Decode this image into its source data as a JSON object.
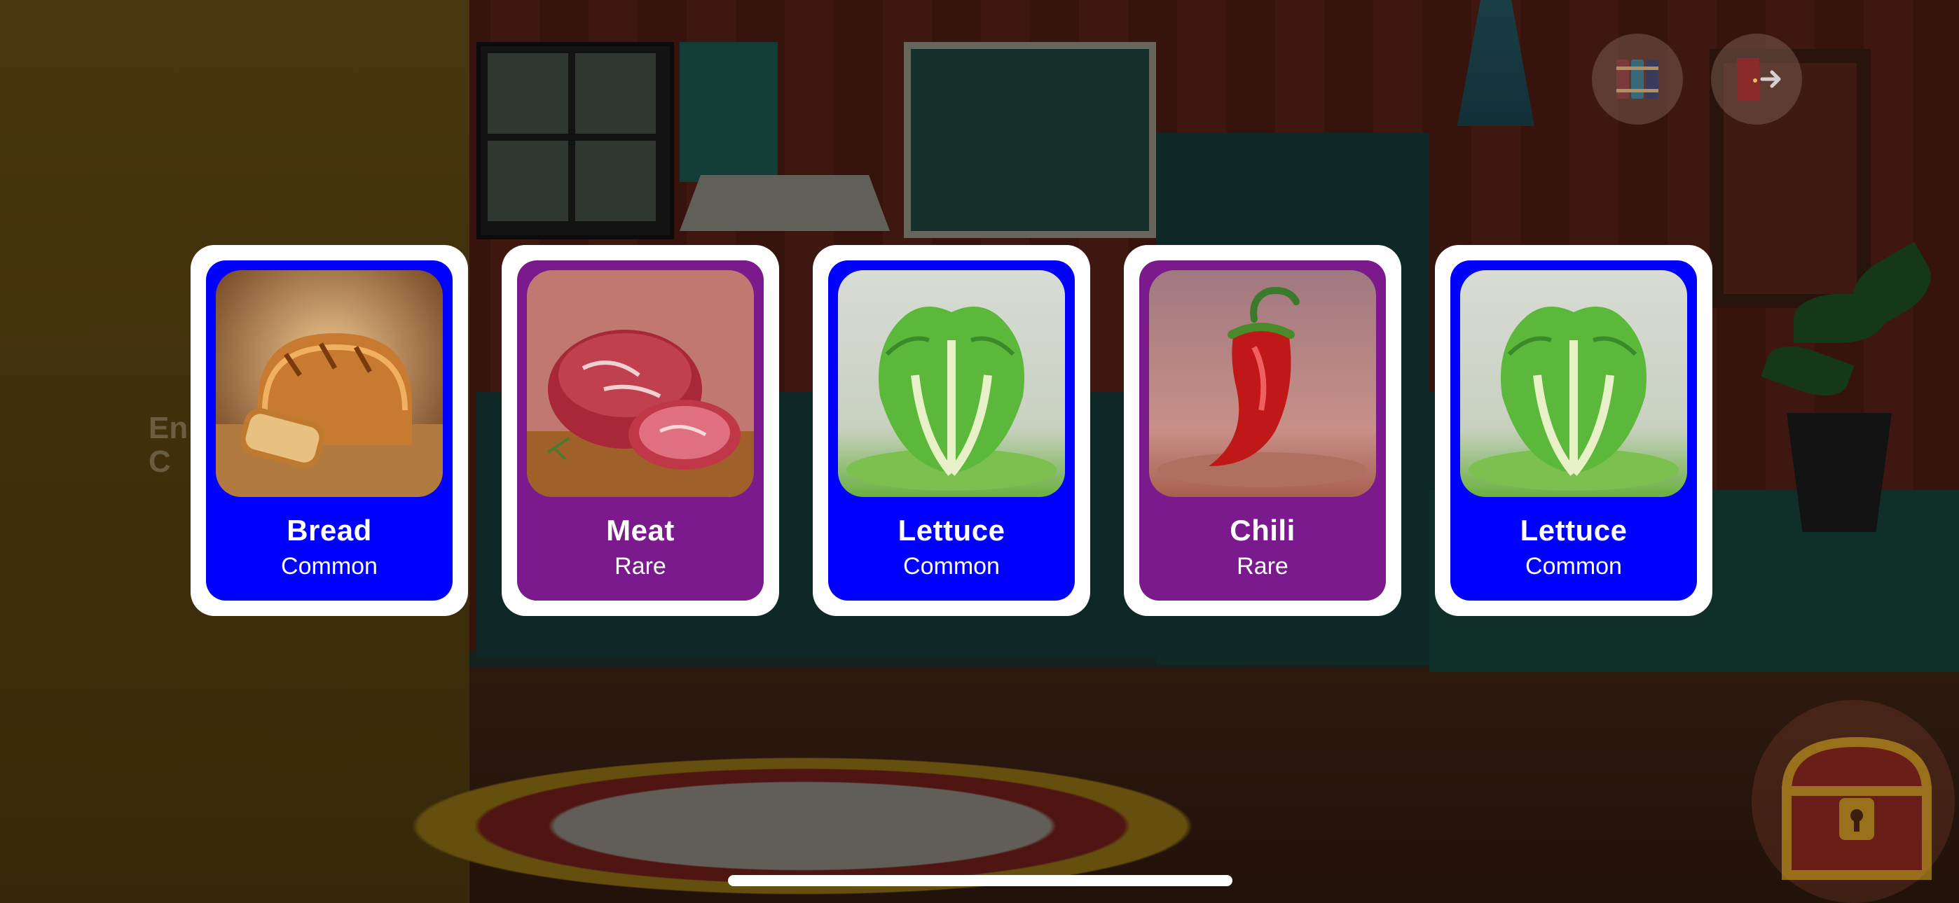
{
  "hint": {
    "line1": "En",
    "line2": "C"
  },
  "top_buttons": {
    "library_icon": "book-stack-icon",
    "exit_icon": "exit-door-icon"
  },
  "cards": [
    {
      "name": "Bread",
      "rarity": "Common",
      "color": "#0000ff",
      "art": "bread-icon"
    },
    {
      "name": "Meat",
      "rarity": "Rare",
      "color": "#7a1a8c",
      "art": "meat-icon"
    },
    {
      "name": "Lettuce",
      "rarity": "Common",
      "color": "#0000ff",
      "art": "lettuce-icon"
    },
    {
      "name": "Chili",
      "rarity": "Rare",
      "color": "#7a1a8c",
      "art": "chili-icon"
    },
    {
      "name": "Lettuce",
      "rarity": "Common",
      "color": "#0000ff",
      "art": "lettuce-icon"
    }
  ],
  "colors": {
    "common": "#0000ff",
    "rare": "#7a1a8c",
    "card_border": "#ffffff"
  },
  "chest_icon": "treasure-chest-icon"
}
